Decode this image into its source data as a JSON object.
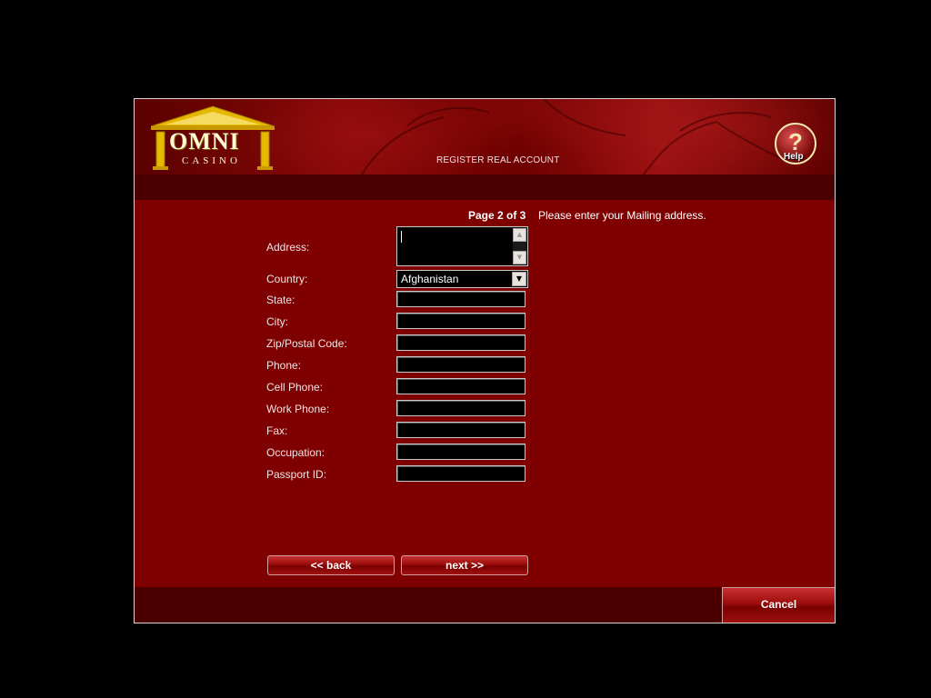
{
  "header": {
    "logo_main": "OMNI",
    "logo_sub": "CASINO",
    "title": "REGISTER REAL ACCOUNT",
    "help_label": "Help",
    "help_icon": "question-mark-icon"
  },
  "page": {
    "indicator": "Page 2 of 3",
    "instruction": "Please enter your Mailing address."
  },
  "form": {
    "address": {
      "label": "Address:",
      "value": ""
    },
    "country": {
      "label": "Country:",
      "value": "Afghanistan"
    },
    "state": {
      "label": "State:",
      "value": ""
    },
    "city": {
      "label": "City:",
      "value": ""
    },
    "zip": {
      "label": "Zip/Postal Code:",
      "value": ""
    },
    "phone": {
      "label": "Phone:",
      "value": ""
    },
    "cell_phone": {
      "label": "Cell Phone:",
      "value": ""
    },
    "work_phone": {
      "label": "Work Phone:",
      "value": ""
    },
    "fax": {
      "label": "Fax:",
      "value": ""
    },
    "occupation": {
      "label": "Occupation:",
      "value": ""
    },
    "passport_id": {
      "label": "Passport ID:",
      "value": ""
    }
  },
  "buttons": {
    "back": "<< back",
    "next": "next >>",
    "cancel": "Cancel"
  },
  "colors": {
    "background": "#7e0000",
    "bar": "#4a0000",
    "logo_gold": "#e6b800"
  }
}
